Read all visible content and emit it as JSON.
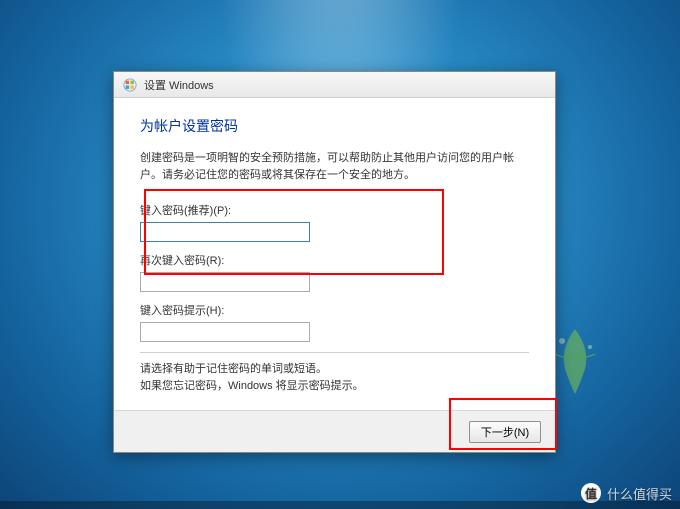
{
  "window": {
    "title": "设置 Windows"
  },
  "main": {
    "heading": "为帐户设置密码",
    "intro": "创建密码是一项明智的安全预防措施，可以帮助防止其他用户访问您的用户帐户。请务必记住您的密码或将其保存在一个安全的地方。",
    "password_label": "键入密码(推荐)(P):",
    "password_value": "",
    "retype_label": "再次键入密码(R):",
    "retype_value": "",
    "hint_label": "键入密码提示(H):",
    "hint_value": "",
    "help_line1": "请选择有助于记住密码的单词或短语。",
    "help_line2": "如果您忘记密码，Windows 将显示密码提示。"
  },
  "footer": {
    "next_label": "下一步(N)"
  },
  "watermark": {
    "badge": "值",
    "text": "什么值得买"
  }
}
